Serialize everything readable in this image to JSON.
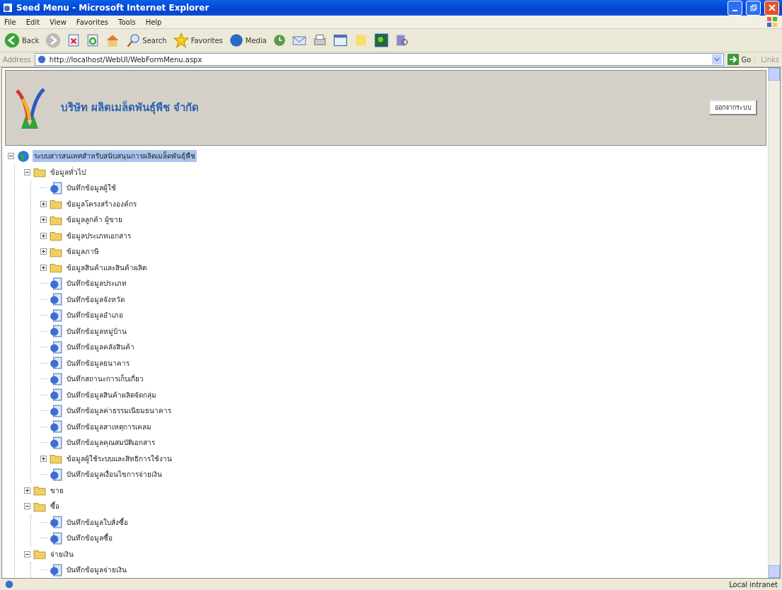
{
  "window": {
    "title": "Seed Menu - Microsoft Internet Explorer"
  },
  "menu": [
    "File",
    "Edit",
    "View",
    "Favorites",
    "Tools",
    "Help"
  ],
  "toolbar": [
    {
      "kind": "back",
      "label": "Back"
    },
    {
      "kind": "forward"
    },
    {
      "kind": "stop"
    },
    {
      "kind": "refresh"
    },
    {
      "kind": "home"
    },
    {
      "kind": "search",
      "label": "Search"
    },
    {
      "kind": "favorites",
      "label": "Favorites"
    },
    {
      "kind": "media",
      "label": "Media"
    },
    {
      "kind": "history"
    },
    {
      "kind": "mail"
    },
    {
      "kind": "print"
    },
    {
      "kind": "edit"
    },
    {
      "kind": "note"
    },
    {
      "kind": "messenger"
    },
    {
      "kind": "research"
    }
  ],
  "address": {
    "label": "Address",
    "value": "http://localhost/WebUI/WebFormMenu.aspx",
    "go": "Go",
    "links": "Links"
  },
  "header": {
    "company": "บริษัท ผลิตเมล็ดพันธุ์พืช จำกัด",
    "logout": "ออกจากระบบ"
  },
  "tree": [
    {
      "kind": "root",
      "label": "ระบบสารสนเทศสำหรับสนับสนุนการผลิตเมล็ดพันธุ์พืช",
      "selected": true,
      "expanded": true,
      "children": [
        {
          "kind": "folder",
          "label": "ข้อมูลทั่วไป",
          "selected": false,
          "expanded": true,
          "children": [
            {
              "kind": "page",
              "label": "บันทึกข้อมูลผู้ใช้",
              "selected": false
            },
            {
              "kind": "folder",
              "label": "ข้อมูลโครงสร้างองค์กร",
              "selected": false,
              "expanded": false
            },
            {
              "kind": "folder",
              "label": "ข้อมูลลูกค้า ผู้ขาย",
              "selected": false,
              "expanded": false
            },
            {
              "kind": "folder",
              "label": "ข้อมูลประเภทเอกสาร",
              "selected": false,
              "expanded": false
            },
            {
              "kind": "folder",
              "label": "ข้อมูลภาษี",
              "selected": false,
              "expanded": false
            },
            {
              "kind": "folder",
              "label": "ข้อมูลสินค้าและสินค้าผลิต",
              "selected": false,
              "expanded": false
            },
            {
              "kind": "page",
              "label": "บันทึกข้อมูลประเภท",
              "selected": false
            },
            {
              "kind": "page",
              "label": "บันทึกข้อมูลจังหวัด",
              "selected": false
            },
            {
              "kind": "page",
              "label": "บันทึกข้อมูลอำเภอ",
              "selected": false
            },
            {
              "kind": "page",
              "label": "บันทึกข้อมูลหมู่บ้าน",
              "selected": false
            },
            {
              "kind": "page",
              "label": "บันทึกข้อมูลคลังสินค้า",
              "selected": false
            },
            {
              "kind": "page",
              "label": "บันทึกข้อมูลธนาคาร",
              "selected": false
            },
            {
              "kind": "page",
              "label": "บันทึกสถานะการเก็บเกี่ยว",
              "selected": false
            },
            {
              "kind": "page",
              "label": "บันทึกข้อมูลสินค้าผลิตจัดกลุ่ม",
              "selected": false
            },
            {
              "kind": "page",
              "label": "บันทึกข้อมูลค่าธรรมเนียมธนาคาร",
              "selected": false
            },
            {
              "kind": "page",
              "label": "บันทึกข้อมูลสาเหตุการเคลม",
              "selected": false
            },
            {
              "kind": "page",
              "label": "บันทึกข้อมูลคุณสมบัติเอกสาร",
              "selected": false
            },
            {
              "kind": "folder",
              "label": "ข้อมูลผู้ใช้ระบบและสิทธิการใช้งาน",
              "selected": false,
              "expanded": false
            },
            {
              "kind": "page",
              "label": "บันทึกข้อมูลเงื่อนไขการจ่ายเงิน",
              "selected": false
            }
          ]
        },
        {
          "kind": "folder",
          "label": "ขาย",
          "selected": false,
          "expanded": false
        },
        {
          "kind": "folder",
          "label": "ซื้อ",
          "selected": false,
          "expanded": true,
          "children": [
            {
              "kind": "page",
              "label": "บันทึกข้อมูลใบสั่งซื้อ",
              "selected": false
            },
            {
              "kind": "page",
              "label": "บันทึกข้อมูลซื้อ",
              "selected": false
            }
          ]
        },
        {
          "kind": "folder",
          "label": "จ่ายเงิน",
          "selected": false,
          "expanded": true,
          "children": [
            {
              "kind": "page",
              "label": "บันทึกข้อมูลจ่ายเงิน",
              "selected": false
            }
          ]
        }
      ]
    }
  ],
  "status_bar": {
    "zone": "Local intranet"
  }
}
